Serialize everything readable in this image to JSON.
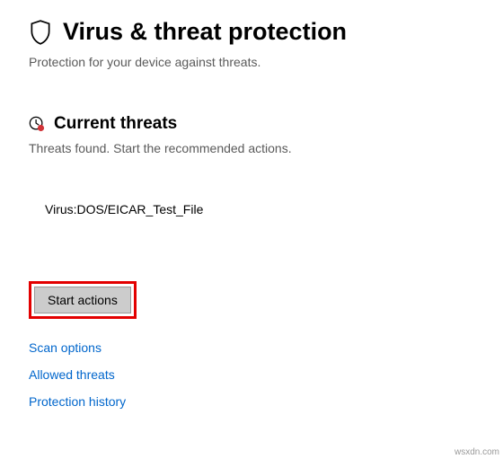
{
  "header": {
    "title": "Virus & threat protection",
    "subtitle": "Protection for your device against threats."
  },
  "current_threats": {
    "title": "Current threats",
    "subtitle": "Threats found. Start the recommended actions.",
    "threat_name": "Virus:DOS/EICAR_Test_File"
  },
  "actions": {
    "start_actions_label": "Start actions"
  },
  "links": {
    "scan_options": "Scan options",
    "allowed_threats": "Allowed threats",
    "protection_history": "Protection history"
  },
  "watermark": "wsxdn.com"
}
